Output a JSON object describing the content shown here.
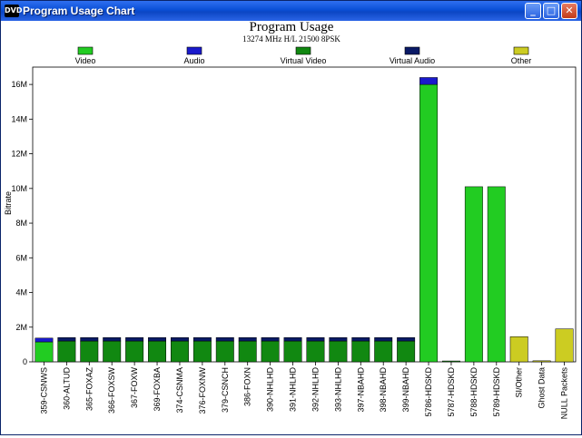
{
  "window": {
    "title": "Program Usage Chart",
    "icon_label": "DVD",
    "buttons": [
      {
        "name": "minimize-button",
        "glyph": "_"
      },
      {
        "name": "maximize-button",
        "glyph": "□"
      },
      {
        "name": "close-button",
        "glyph": "✕"
      }
    ]
  },
  "chart_data": {
    "type": "bar",
    "title": "Program Usage",
    "subtitle": "13274 MHz H/L 21500 8PSK",
    "ylabel": "Bitrate",
    "xlabel": "",
    "ylim": [
      0,
      17000000
    ],
    "yticks": [
      0,
      2000000,
      4000000,
      6000000,
      8000000,
      10000000,
      12000000,
      14000000,
      16000000
    ],
    "ytick_labels": [
      "0",
      "2M",
      "4M",
      "6M",
      "8M",
      "10M",
      "12M",
      "14M",
      "16M"
    ],
    "grid": false,
    "legend_position": "top",
    "legend": [
      {
        "name": "Video",
        "color": "#22cc22"
      },
      {
        "name": "Audio",
        "color": "#1a1acc"
      },
      {
        "name": "Virtual Video",
        "color": "#118811"
      },
      {
        "name": "Virtual Audio",
        "color": "#0a1a66"
      },
      {
        "name": "Other",
        "color": "#cccc22"
      }
    ],
    "categories": [
      "359-CSNWS",
      "360-ALTUD",
      "365-FOXAZ",
      "366-FOXSW",
      "367-FOXW",
      "369-FOXBA",
      "374-CSNMA",
      "376-FOXNW",
      "379-CSNCH",
      "386-FOXN",
      "390-NHLHD",
      "391-NHLHD",
      "392-NHLHD",
      "393-NHLHD",
      "397-NBAHD",
      "398-NBAHD",
      "399-NBAHD",
      "5786-HDSKD",
      "5787-HDSKD",
      "5788-HDSKD",
      "5789-HDSKD",
      "SI/Other",
      "Ghost Data",
      "NULL Packets"
    ],
    "series": [
      {
        "name": "Video",
        "color": "#22cc22",
        "values": [
          1150000,
          0,
          0,
          0,
          0,
          0,
          0,
          0,
          0,
          0,
          0,
          0,
          0,
          0,
          0,
          0,
          0,
          16000000,
          0,
          10100000,
          10100000,
          0,
          0,
          0
        ]
      },
      {
        "name": "Audio",
        "color": "#1a1acc",
        "values": [
          220000,
          0,
          0,
          0,
          0,
          0,
          0,
          0,
          0,
          0,
          0,
          0,
          0,
          0,
          0,
          0,
          0,
          400000,
          0,
          0,
          0,
          0,
          0,
          0
        ]
      },
      {
        "name": "Virtual Video",
        "color": "#118811",
        "values": [
          0,
          1200000,
          1200000,
          1200000,
          1200000,
          1200000,
          1200000,
          1200000,
          1200000,
          1200000,
          1200000,
          1200000,
          1200000,
          1200000,
          1200000,
          1200000,
          1200000,
          0,
          50000,
          0,
          0,
          0,
          0,
          0
        ]
      },
      {
        "name": "Virtual Audio",
        "color": "#0a1a66",
        "values": [
          0,
          200000,
          200000,
          200000,
          200000,
          200000,
          200000,
          200000,
          200000,
          200000,
          200000,
          200000,
          200000,
          200000,
          200000,
          200000,
          200000,
          0,
          0,
          0,
          0,
          0,
          0,
          0
        ]
      },
      {
        "name": "Other",
        "color": "#cccc22",
        "values": [
          0,
          0,
          0,
          0,
          0,
          0,
          0,
          0,
          0,
          0,
          0,
          0,
          0,
          0,
          0,
          0,
          0,
          0,
          0,
          0,
          0,
          1450000,
          60000,
          1900000
        ]
      }
    ]
  }
}
